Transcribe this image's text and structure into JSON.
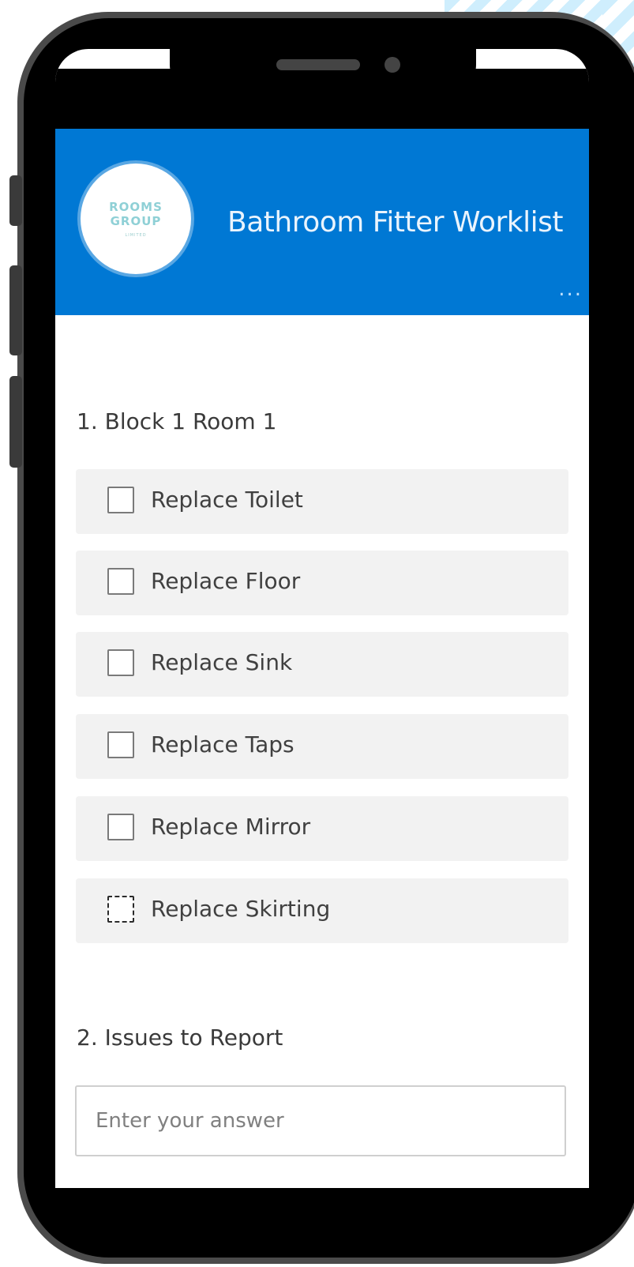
{
  "app": {
    "title": "Bathroom Fitter Worklist",
    "more_label": "...",
    "logo": {
      "line1": "ROOMS",
      "line2": "GROUP",
      "sub": "LIMITED"
    }
  },
  "question1": {
    "title": "1. Block 1 Room 1",
    "options": [
      {
        "label": "Replace Toilet",
        "checked": false
      },
      {
        "label": "Replace Floor",
        "checked": false
      },
      {
        "label": "Replace Sink",
        "checked": false
      },
      {
        "label": "Replace Taps",
        "checked": false
      },
      {
        "label": "Replace Mirror",
        "checked": false
      },
      {
        "label": "Replace Skirting",
        "checked": false
      }
    ]
  },
  "question2": {
    "title": "2. Issues to Report",
    "placeholder": "Enter your answer",
    "value": ""
  },
  "colors": {
    "header": "#0078d4",
    "frame": "#4a4a4a",
    "option_bg": "#f2f2f2"
  }
}
